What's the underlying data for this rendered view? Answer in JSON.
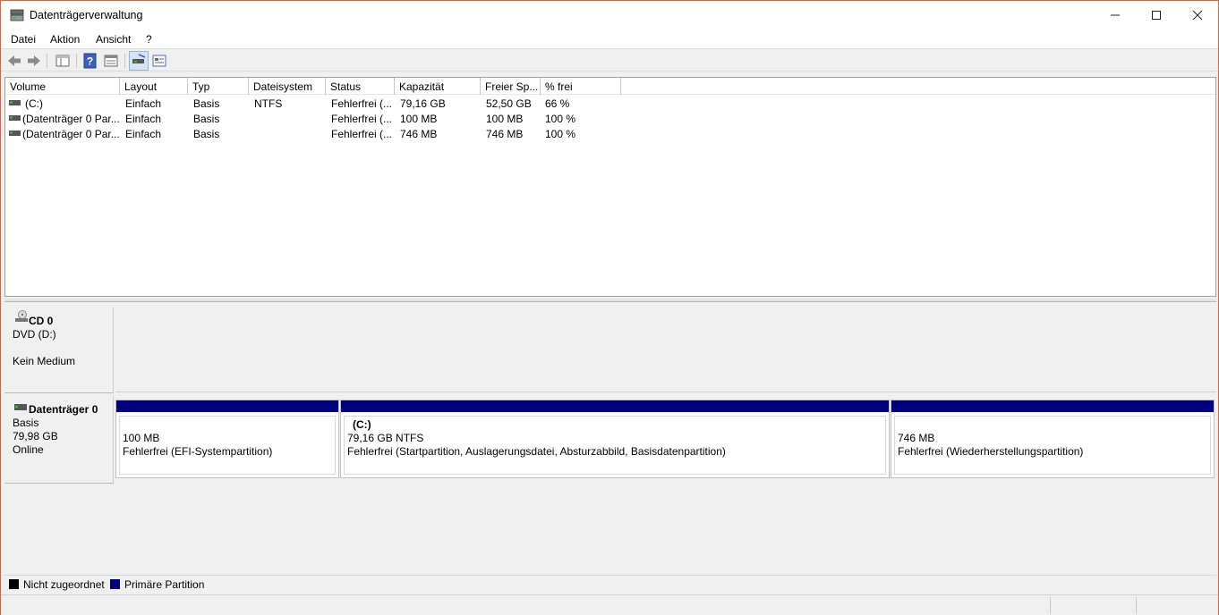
{
  "window": {
    "title": "Datenträgerverwaltung",
    "minimize_icon": "minimize-icon",
    "maximize_icon": "maximize-icon",
    "close_icon": "close-icon",
    "accent_border": "#d8633e"
  },
  "menu": {
    "items": [
      "Datei",
      "Aktion",
      "Ansicht",
      "?"
    ]
  },
  "toolbar": {
    "buttons": [
      "back-arrow-icon",
      "forward-arrow-icon",
      "console-tree-icon",
      "help-icon",
      "properties-icon",
      "disk-list-icon",
      "graphical-view-icon"
    ]
  },
  "volume_list": {
    "columns": [
      "Volume",
      "Layout",
      "Typ",
      "Dateisystem",
      "Status",
      "Kapazität",
      "Freier Sp...",
      "% frei"
    ],
    "rows": [
      {
        "volume": "(C:)",
        "layout": "Einfach",
        "typ": "Basis",
        "dateisystem": "NTFS",
        "status": "Fehlerfrei (...",
        "kapazitaet": "79,16 GB",
        "frei": "52,50 GB",
        "prozent": "66 %"
      },
      {
        "volume": "(Datenträger 0 Par...",
        "layout": "Einfach",
        "typ": "Basis",
        "dateisystem": "",
        "status": "Fehlerfrei (...",
        "kapazitaet": "100 MB",
        "frei": "100 MB",
        "prozent": "100 %"
      },
      {
        "volume": "(Datenträger 0 Par...",
        "layout": "Einfach",
        "typ": "Basis",
        "dateisystem": "",
        "status": "Fehlerfrei (...",
        "kapazitaet": "746 MB",
        "frei": "746 MB",
        "prozent": "100 %"
      }
    ]
  },
  "cd": {
    "name": "CD 0",
    "line1": "DVD (D:)",
    "line2": "Kein Medium"
  },
  "disk0": {
    "name": "Datenträger 0",
    "type": "Basis",
    "size": "79,98 GB",
    "state": "Online",
    "partitions": [
      {
        "title": "",
        "size": "100 MB",
        "status": "Fehlerfrei (EFI-Systempartition)"
      },
      {
        "title": "(C:)",
        "size": "79,16 GB NTFS",
        "status": "Fehlerfrei (Startpartition, Auslagerungsdatei, Absturzabbild, Basisdatenpartition)"
      },
      {
        "title": "",
        "size": "746 MB",
        "status": "Fehlerfrei (Wiederherstellungspartition)"
      }
    ]
  },
  "legend": {
    "unallocated": "Nicht zugeordnet",
    "primary": "Primäre Partition",
    "unallocated_color": "#000000",
    "primary_color": "#00007f"
  }
}
